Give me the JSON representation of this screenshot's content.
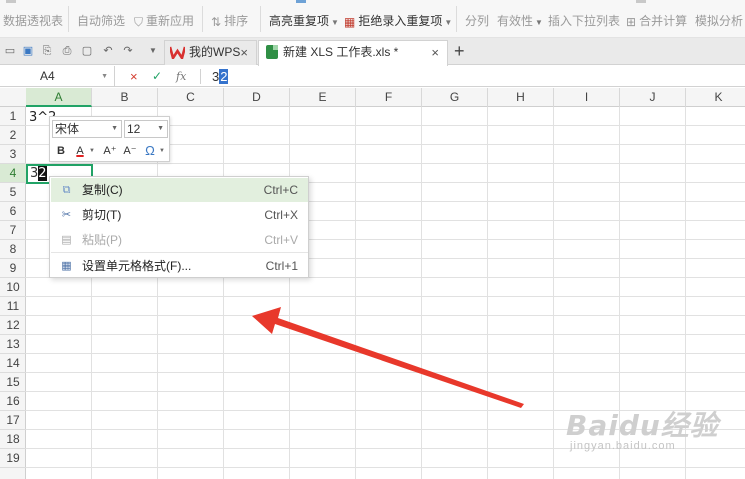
{
  "ribbon": {
    "items": [
      {
        "label": "数据透视表",
        "icon": "pivot-icon"
      },
      {
        "label": "自动筛选",
        "icon": "filter-icon"
      },
      {
        "label": "重新应用",
        "icon": "reapply-icon"
      },
      {
        "label": "排序",
        "icon": "sort-icon"
      },
      {
        "label": "高亮重复项",
        "icon": "highlight-duplicates-icon"
      },
      {
        "label": "拒绝录入重复项",
        "icon": "reject-duplicates-icon"
      },
      {
        "label": "分列",
        "icon": "split-column-icon"
      },
      {
        "label": "有效性",
        "icon": "validation-icon"
      },
      {
        "label": "插入下拉列表",
        "icon": "dropdown-list-icon"
      },
      {
        "label": "合并计算",
        "icon": "consolidate-icon"
      },
      {
        "label": "模拟分析",
        "icon": "what-if-icon"
      }
    ]
  },
  "tabs": [
    {
      "label": "我的WPS",
      "close": "×"
    },
    {
      "label": "新建 XLS 工作表.xls *",
      "close": "×"
    }
  ],
  "tab_plus": "+",
  "formula_bar": {
    "name_box": "A4",
    "cancel": "×",
    "confirm": "✓",
    "fx": "fx",
    "content_plain": "3",
    "content_selected": "2"
  },
  "columns": [
    "A",
    "B",
    "C",
    "D",
    "E",
    "F",
    "G",
    "H",
    "I",
    "J",
    "K"
  ],
  "rows": [
    "1",
    "2",
    "3",
    "4",
    "5",
    "6",
    "7",
    "8",
    "9",
    "10",
    "11",
    "12",
    "13",
    "14",
    "15",
    "16",
    "17",
    "18",
    "19"
  ],
  "active_column": "A",
  "active_row": "4",
  "cells": {
    "A1": "3^2",
    "A4_plain": "3",
    "A4_selected": "2"
  },
  "mini_toolbar": {
    "font_name": "宋体",
    "font_size": "12",
    "bold": "B",
    "font_color": "A",
    "grow": "A⁺",
    "shrink": "A⁻",
    "special": "Ω"
  },
  "context_menu": [
    {
      "label": "复制(C)",
      "shortcut": "Ctrl+C",
      "icon": "copy-icon",
      "state": "hover"
    },
    {
      "label": "剪切(T)",
      "shortcut": "Ctrl+X",
      "icon": "cut-icon",
      "state": "normal"
    },
    {
      "label": "粘贴(P)",
      "shortcut": "Ctrl+V",
      "icon": "paste-icon",
      "state": "disabled"
    },
    {
      "label": "设置单元格格式(F)...",
      "shortcut": "Ctrl+1",
      "icon": "format-cells-icon",
      "state": "normal"
    }
  ],
  "watermark": {
    "main": "Baidu经验",
    "sub": "jingyan.baidu.com"
  },
  "colors": {
    "accent": "#21a366",
    "arrow": "#e8382b",
    "hover": "#e2efde"
  }
}
